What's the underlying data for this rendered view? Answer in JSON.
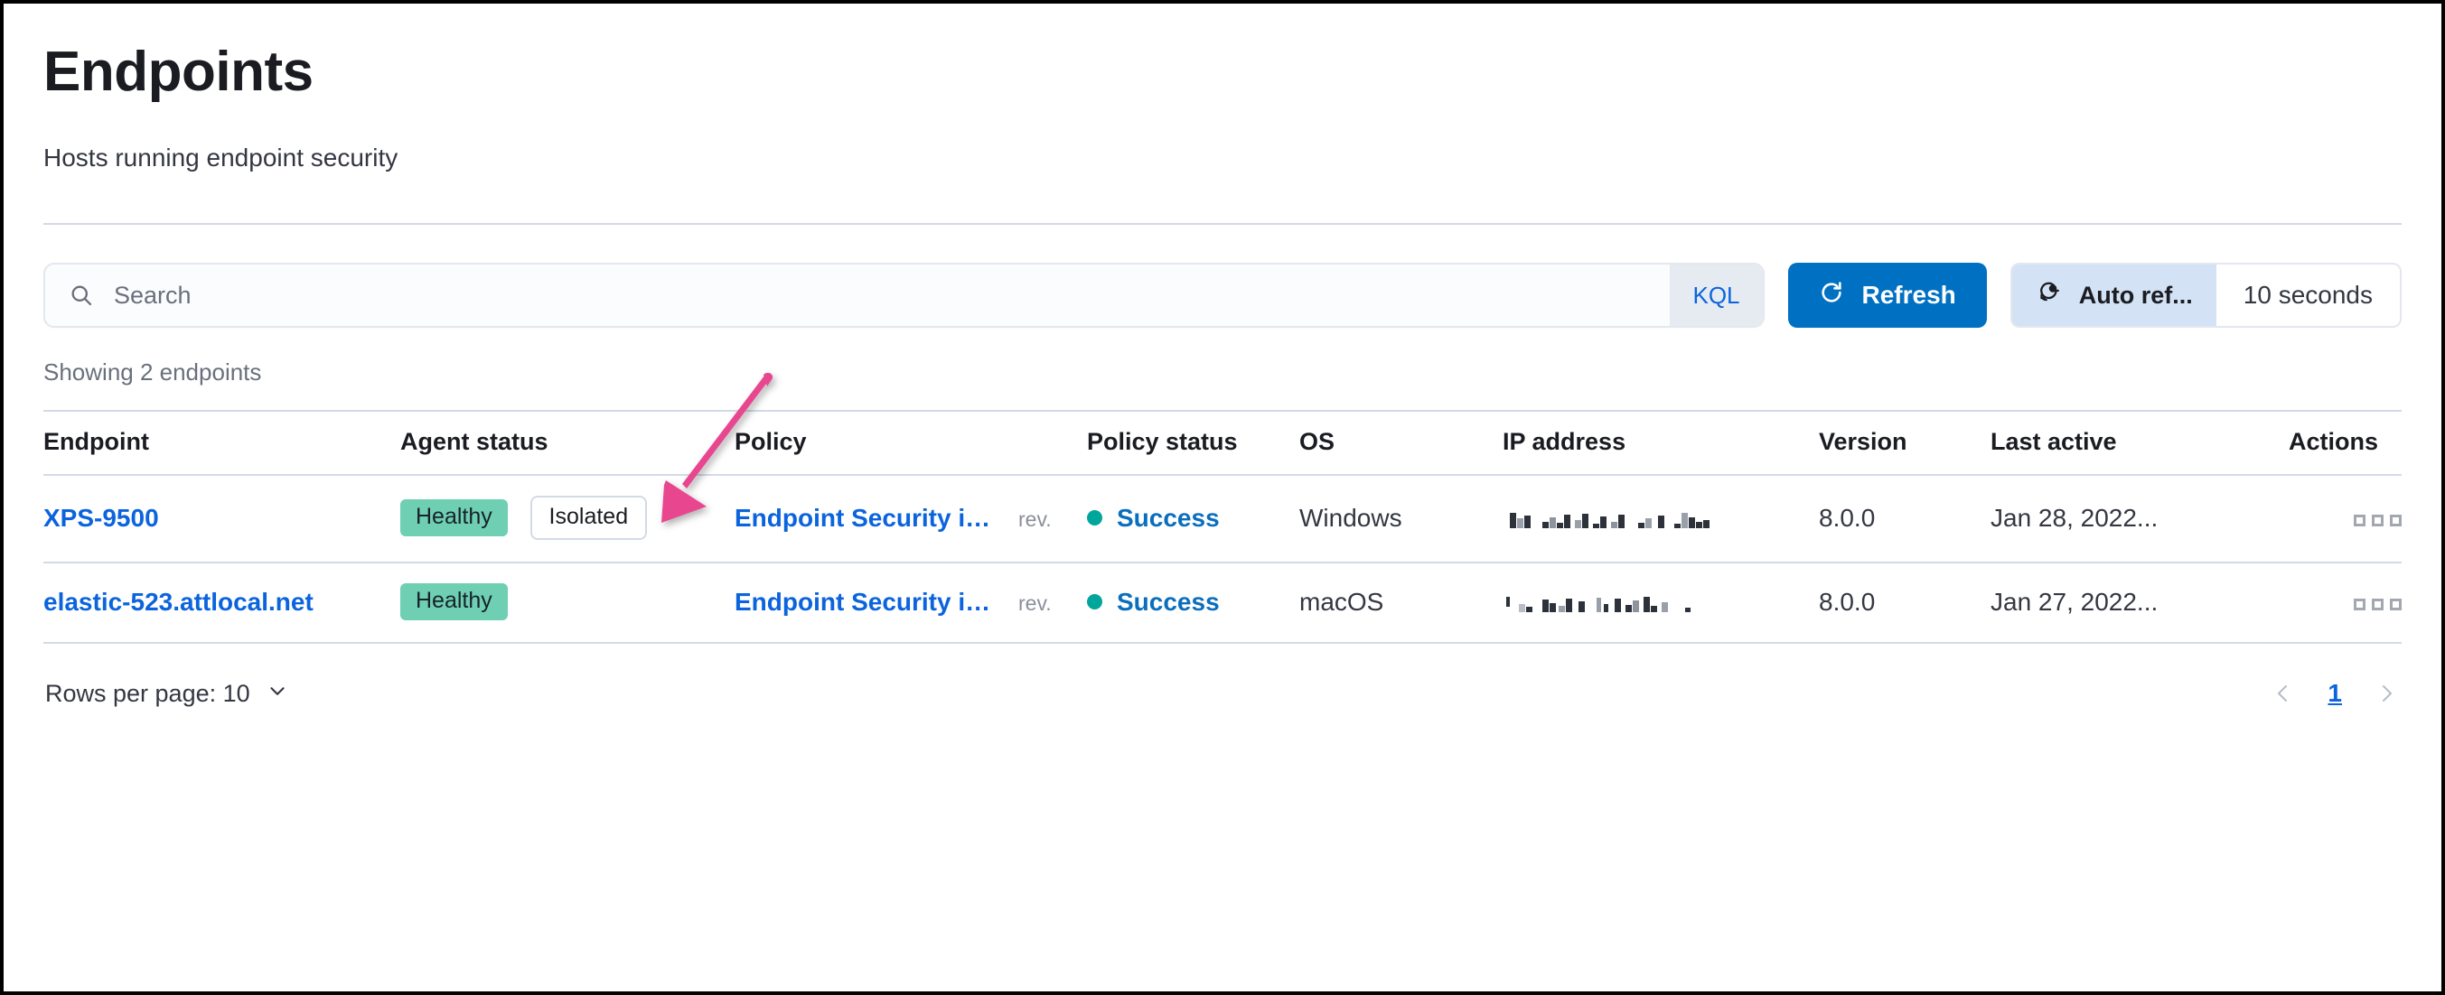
{
  "header": {
    "title": "Endpoints",
    "subtitle": "Hosts running endpoint security"
  },
  "toolbar": {
    "search_placeholder": "Search",
    "search_value": "",
    "kql_label": "KQL",
    "refresh_label": "Refresh",
    "auto_refresh_label": "Auto ref...",
    "auto_refresh_interval": "10 seconds"
  },
  "table": {
    "showing_text": "Showing 2 endpoints",
    "columns": [
      "Endpoint",
      "Agent status",
      "Policy",
      "Policy status",
      "OS",
      "IP address",
      "Version",
      "Last active",
      "Actions"
    ],
    "rows": [
      {
        "endpoint": "XPS-9500",
        "agent_status": "Healthy",
        "isolated_badge": "Isolated",
        "policy": "Endpoint Security int...",
        "policy_rev": "rev.",
        "policy_status": "Success",
        "os": "Windows",
        "ip_address": "",
        "version": "8.0.0",
        "last_active": "Jan 28, 2022...",
        "actions": "actions-menu"
      },
      {
        "endpoint": "elastic-523.attlocal.net",
        "agent_status": "Healthy",
        "isolated_badge": "",
        "policy": "Endpoint Security int...",
        "policy_rev": "rev.",
        "policy_status": "Success",
        "os": "macOS",
        "ip_address": "",
        "version": "8.0.0",
        "last_active": "Jan 27, 2022...",
        "actions": "actions-menu"
      }
    ]
  },
  "footer": {
    "rows_per_page_label": "Rows per page: 10",
    "current_page": "1"
  },
  "annotation": {
    "arrow_color": "#e8468f",
    "points_to": "isolated-badge"
  },
  "colors": {
    "primary_button": "#0071c2",
    "link": "#0b64dd",
    "healthy_badge": "#6ecfb2",
    "success_dot": "#00a69b",
    "arrow_pink": "#e8468f",
    "border": "#d3dae6"
  }
}
